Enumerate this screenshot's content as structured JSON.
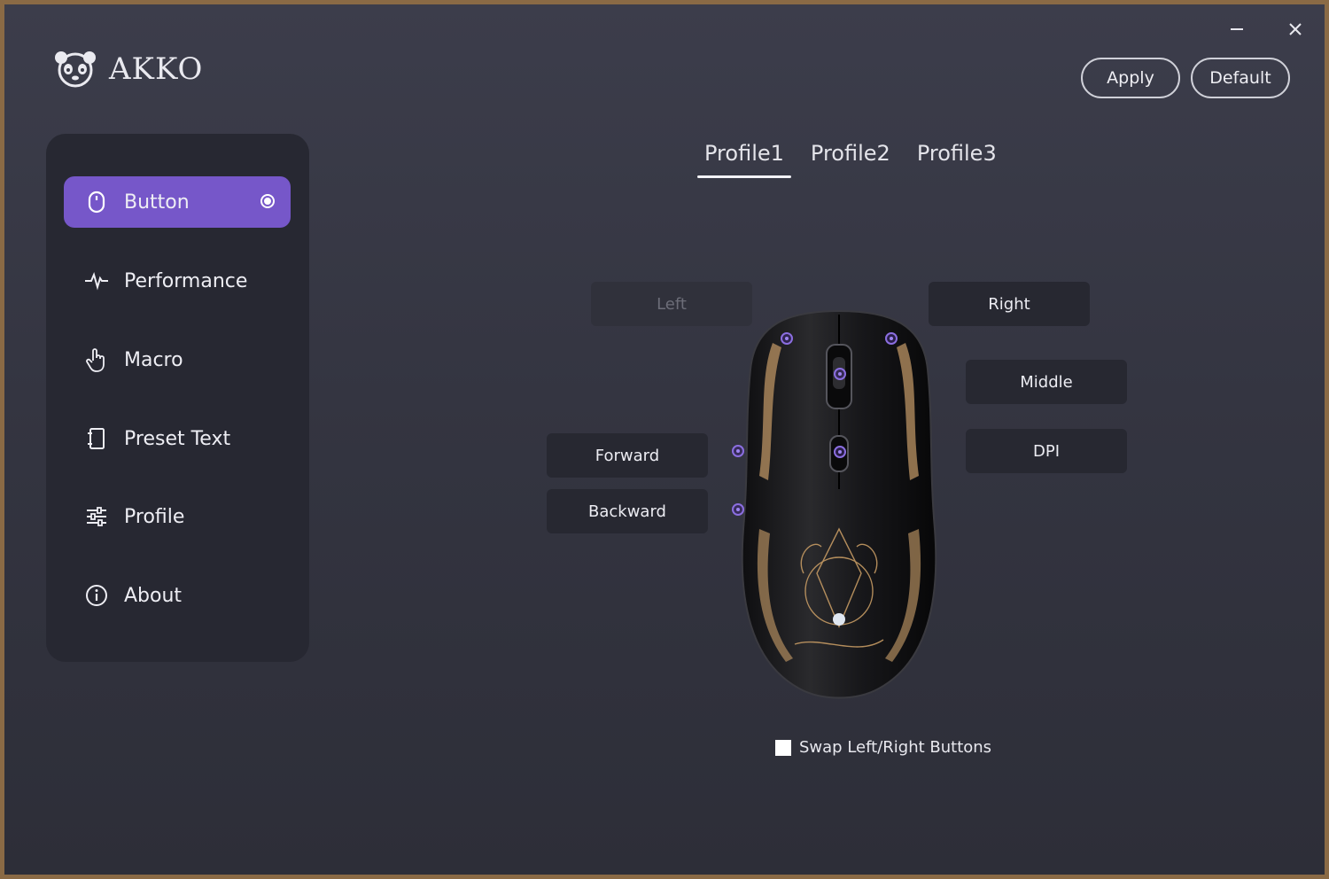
{
  "app": {
    "brand": "AKKO"
  },
  "window_controls": {
    "minimize": "minimize-icon",
    "close": "close-icon"
  },
  "actions": {
    "apply": "Apply",
    "default": "Default"
  },
  "sidebar": {
    "items": [
      {
        "label": "Button",
        "icon": "mouse-icon",
        "active": true
      },
      {
        "label": "Performance",
        "icon": "pulse-icon",
        "active": false
      },
      {
        "label": "Macro",
        "icon": "hand-pointer-icon",
        "active": false
      },
      {
        "label": "Preset Text",
        "icon": "notebook-icon",
        "active": false
      },
      {
        "label": "Profile",
        "icon": "sliders-icon",
        "active": false
      },
      {
        "label": "About",
        "icon": "info-icon",
        "active": false
      }
    ]
  },
  "profiles": {
    "tabs": [
      "Profile1",
      "Profile2",
      "Profile3"
    ],
    "active": "Profile1"
  },
  "mouse_buttons": {
    "left": "Left",
    "right": "Right",
    "middle": "Middle",
    "dpi": "DPI",
    "forward": "Forward",
    "backward": "Backward"
  },
  "swap": {
    "label": "Swap Left/Right Buttons",
    "checked": false
  },
  "colors": {
    "accent": "#7657c9",
    "sidebar_bg": "#272832",
    "button_bg": "#272831"
  }
}
